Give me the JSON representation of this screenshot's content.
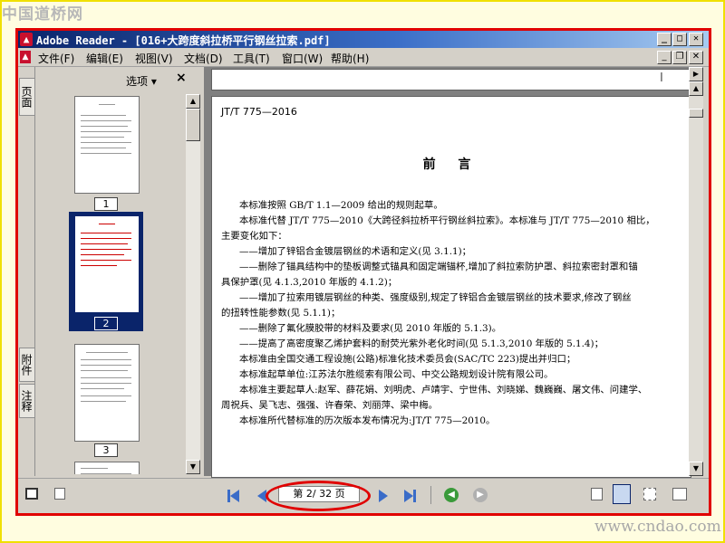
{
  "watermark": {
    "top": "中国道桥网",
    "bottom": "www.cndao.com"
  },
  "window": {
    "title": "Adobe Reader - [016+大跨度斜拉桥平行钢丝拉索.pdf]",
    "icon": "acrobat-icon"
  },
  "menu": {
    "items": [
      "文件(F)",
      "编辑(E)",
      "视图(V)",
      "文档(D)",
      "工具(T)",
      "窗口(W)",
      "帮助(H)"
    ]
  },
  "side_tabs": {
    "pages": "页面",
    "attachments": "附件",
    "comments": "注释"
  },
  "nav_panel": {
    "options_label": "选项 ▾",
    "close_label": "×",
    "thumbnails": [
      {
        "number": "1"
      },
      {
        "number": "2"
      },
      {
        "number": "3"
      }
    ]
  },
  "cursor_glyph": "I",
  "document": {
    "header": "JT/T 775—2016",
    "title": "前  言",
    "paragraphs": [
      "本标准按照 GB/T 1.1—2009 给出的规则起草。",
      "本标准代替 JT/T 775—2010《大跨径斜拉桥平行钢丝斜拉索》。本标准与 JT/T 775—2010 相比，",
      "主要变化如下：",
      "——增加了锌铝合金镀层钢丝的术语和定义(见 3.1.1)；",
      "——删除了锚具结构中的垫板调整式锚具和固定端锚杯,增加了斜拉索防护罩、斜拉索密封罩和锚",
      "具保护罩(见 4.1.3,2010 年版的 4.1.2)；",
      "——增加了拉索用镀层钢丝的种类、强度级别,规定了锌铝合金镀层钢丝的技术要求,修改了钢丝",
      "的扭转性能参数(见 5.1.1)；",
      "——删除了氟化膜胶带的材料及要求(见 2010 年版的 5.1.3)。",
      "——提高了高密度聚乙烯护套料的耐荧光紫外老化时间(见 5.1.3,2010 年版的 5.1.4)；",
      "本标准由全国交通工程设施(公路)标准化技术委员会(SAC/TC 223)提出并归口；",
      "本标准起草单位:江苏法尔胜缆索有限公司、中交公路规划设计院有限公司。",
      "本标准主要起草人:赵军、薛花娟、刘明虎、卢靖宇、宁世伟、刘晓娣、魏巍巍、屠文伟、问建学、",
      "周祝兵、吴飞志、强强、许春荣、刘丽萍、梁中梅。",
      "本标准所代替标准的历次版本发布情况为:JT/T 775—2010。"
    ]
  },
  "status_bar": {
    "page_indicator": "第 2/ 32 页"
  },
  "colors": {
    "accent_red": "#e00000",
    "title_blue": "#0a246a",
    "frame_yellow": "#f0e000"
  }
}
